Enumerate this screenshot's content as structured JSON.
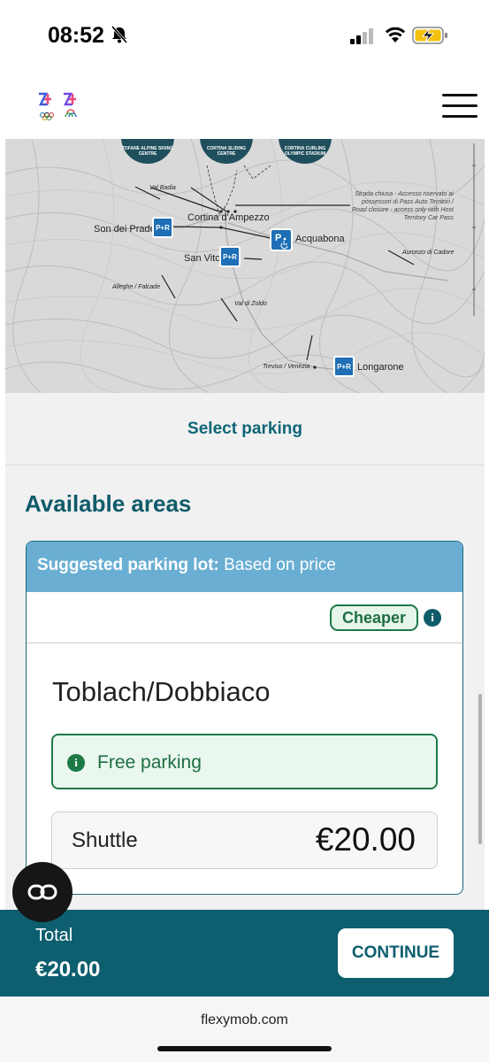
{
  "status_bar": {
    "time": "08:52"
  },
  "map": {
    "venues": [
      {
        "name": "TOFANE ALPINE SKIING CENTRE"
      },
      {
        "name": "CORTINA SLIDING CENTRE"
      },
      {
        "name": "CORTINA CURLING OLYMPIC STADIUM"
      }
    ],
    "labels": {
      "val_badia": "Val Badia",
      "cortina": "Cortina d'Ampezzo",
      "son_dei_prade": "Son dei Prade",
      "acquabona": "Acquabona",
      "san_vito": "San Vito",
      "auronzo": "Auronzo di Cadore",
      "alleghe": "Alleghe / Falcade",
      "val_di_zoldo": "Val di Zoldo",
      "treviso": "Treviso / Venezia",
      "longarone": "Longarone",
      "road_note_1": "Strada chiusa - Accesso riservato ai",
      "road_note_2": "possessori di Pass Auto Territori /",
      "road_note_3": "Road closure - access only with Host",
      "road_note_4": "Territory Car Pass"
    },
    "pr_label": "P+R"
  },
  "select_parking": "Select parking",
  "available_areas": "Available areas",
  "card": {
    "suggested_label": "Suggested parking lot:",
    "suggested_value": " Based on price",
    "tag": "Cheaper",
    "lot_name": "Toblach/Dobbiaco",
    "free_parking": "Free parking",
    "shuttle_label": "Shuttle",
    "shuttle_price": "€20.00"
  },
  "footer": {
    "total_label": "Total",
    "total_value": "€20.00",
    "continue": "CONTINUE"
  },
  "browser": {
    "url": "flexymob.com"
  }
}
